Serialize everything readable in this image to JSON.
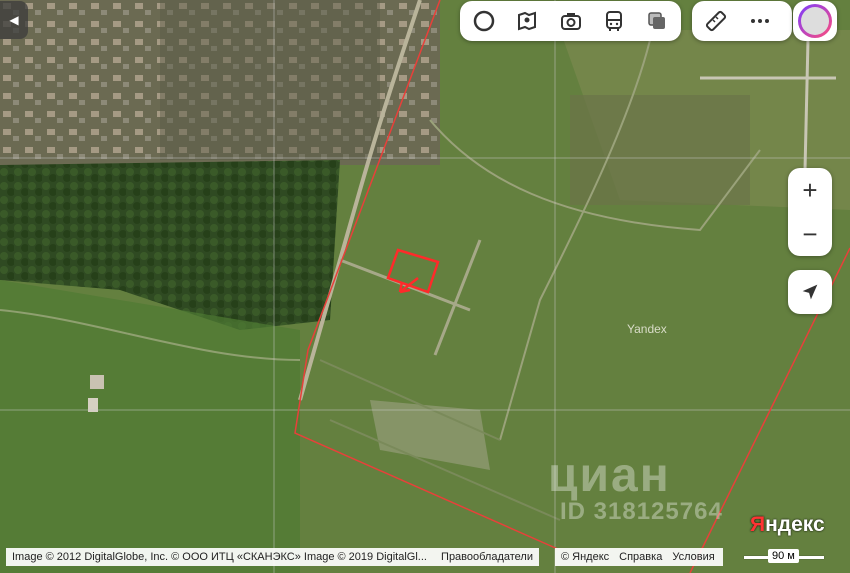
{
  "map": {
    "watermark_brand": "циан",
    "watermark_id": "ID 318125764",
    "tile_label": "Yandex",
    "logo_first": "Я",
    "logo_rest": "ндекс"
  },
  "toolbar": {
    "layers": [
      "panorama-icon",
      "street-photo-icon",
      "camera-icon",
      "bus-icon",
      "layers-icon"
    ],
    "tools": [
      "ruler-icon",
      "more-icon"
    ]
  },
  "zoom": {
    "plus": "+",
    "minus": "−"
  },
  "footer": {
    "attribution": "Image © 2012 DigitalGlobe, Inc. © ООО ИТЦ «СКАНЭКС» Image © 2019 DigitalGl...",
    "rights_holders": "Правообладатели",
    "copyright": "© Яндекс",
    "help": "Справка",
    "terms": "Условия",
    "scale": "90 м"
  },
  "colors": {
    "boundary": "#e8403a",
    "accent": "#ff3333"
  }
}
